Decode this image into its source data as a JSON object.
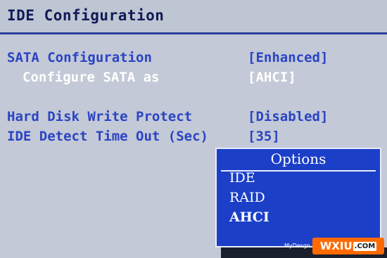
{
  "header": {
    "title": "IDE Configuration"
  },
  "settings": [
    {
      "label": "SATA Configuration",
      "value": "[Enhanced]"
    },
    {
      "label": "Configure SATA as",
      "value": "[AHCI]"
    },
    {
      "label": "Hard Disk Write Protect",
      "value": "[Disabled]"
    },
    {
      "label": "IDE Detect Time Out (Sec)",
      "value": "[35]"
    }
  ],
  "popup": {
    "title": "Options",
    "options": [
      "IDE",
      "RAID",
      "AHCI"
    ],
    "selected": "AHCI"
  },
  "watermark": {
    "small": "MyDesgn",
    "brand": "WXIU",
    "domain": ".COM"
  },
  "colors": {
    "background": "#c3c9d6",
    "accent_blue": "#2a44c4",
    "popup_blue": "#1c3fc8",
    "title_text": "#101a55",
    "watermark_orange": "#ff6a00"
  }
}
